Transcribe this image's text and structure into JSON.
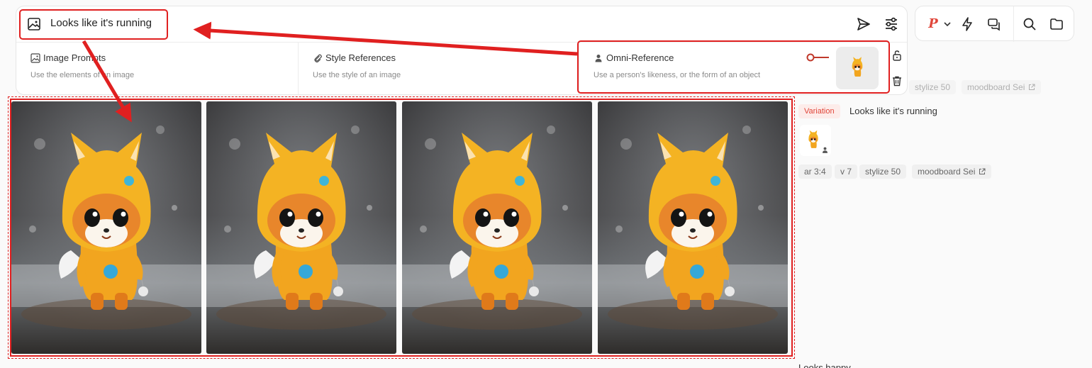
{
  "prompt": {
    "text": "Looks like it's running"
  },
  "references": [
    {
      "title": "Image Prompts",
      "description": "Use the elements of an image",
      "icon": "image-icon"
    },
    {
      "title": "Style References",
      "description": "Use the style of an image",
      "icon": "paperclip-icon"
    },
    {
      "title": "Omni-Reference",
      "description": "Use a person's likeness, or the form of an object",
      "icon": "person-icon"
    }
  ],
  "toolbar": {
    "brand_letter": "P",
    "icons": [
      "chevron-down-icon",
      "lightning-icon",
      "chat-icon",
      "search-icon",
      "folder-icon"
    ]
  },
  "faded_tags": [
    "stylize 50",
    "moodboard Sei"
  ],
  "job": {
    "badge": "Variation",
    "prompt": "Looks like it's running",
    "tags": [
      "ar 3:4",
      "v 7",
      "stylize 50",
      "moodboard Sei"
    ]
  },
  "next_job_prompt": "Looks happy",
  "colors": {
    "accent": "#e0463a",
    "annotation": "#e02020"
  }
}
